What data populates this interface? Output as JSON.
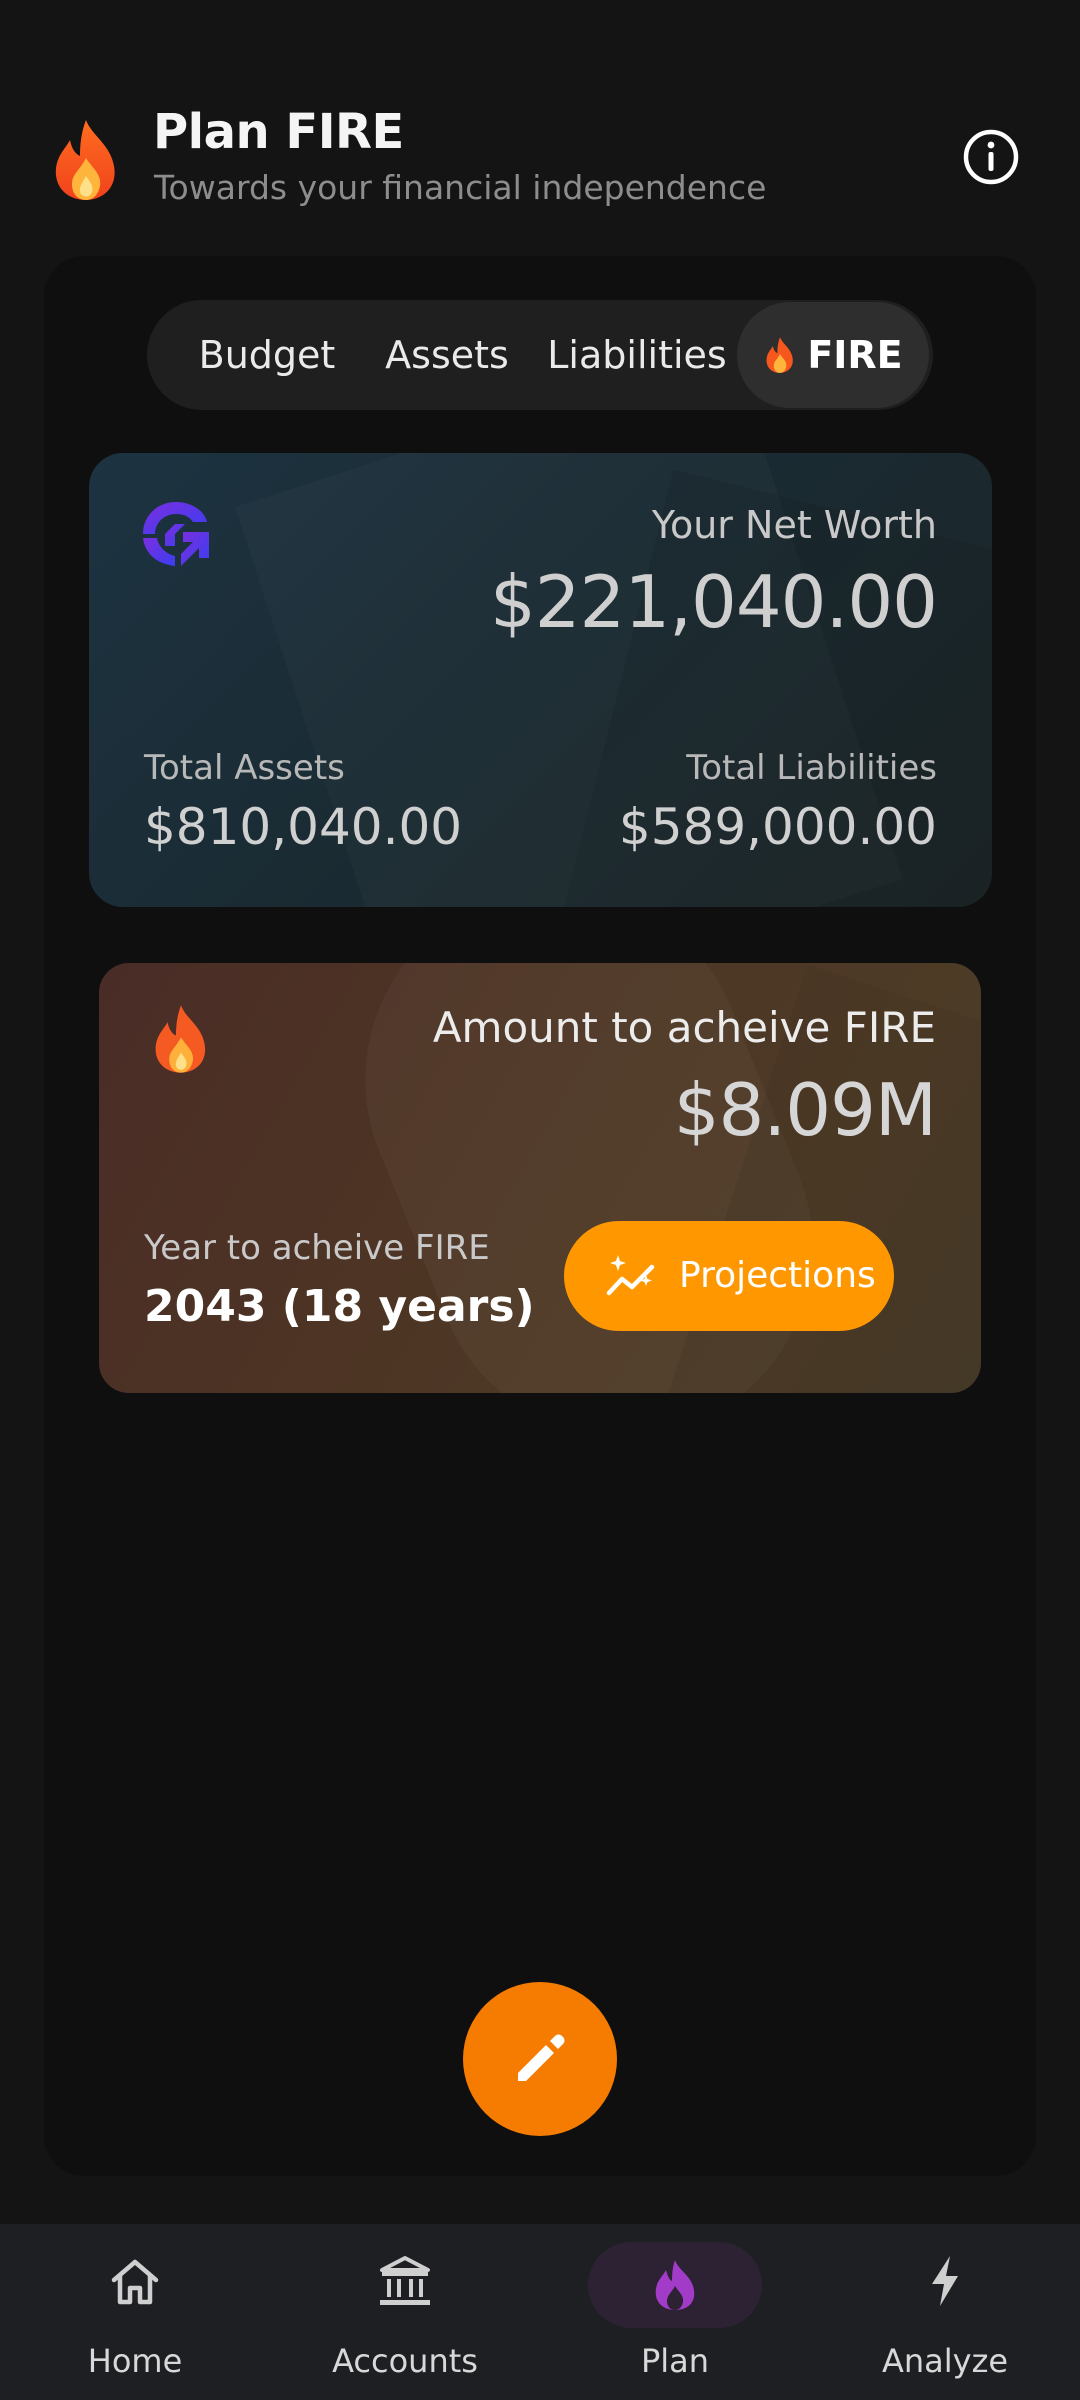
{
  "header": {
    "title": "Plan FIRE",
    "subtitle": "Towards your financial independence",
    "icon": "flame-icon",
    "info_icon": "info-icon"
  },
  "tabs": [
    {
      "label": "Budget",
      "selected": false
    },
    {
      "label": "Assets",
      "selected": false
    },
    {
      "label": "Liabilities",
      "selected": false
    },
    {
      "label": "FIRE",
      "selected": true
    }
  ],
  "net_worth_card": {
    "logo": "brand-logo-icon",
    "label": "Your Net Worth",
    "value": "$221,040.00",
    "total_assets_label": "Total Assets",
    "total_assets_value": "$810,040.00",
    "total_liabilities_label": "Total Liabilities",
    "total_liabilities_value": "$589,000.00"
  },
  "fire_card": {
    "icon": "flame-icon",
    "amount_label": "Amount to acheive FIRE",
    "amount_value": "$8.09M",
    "year_label": "Year to acheive FIRE",
    "year_value": "2043 (18 years)",
    "projections_button": "Projections",
    "projections_icon": "sparkle-chart-icon"
  },
  "fab": {
    "icon": "pencil-icon"
  },
  "bottom_nav": {
    "items": [
      {
        "label": "Home",
        "icon": "home-icon",
        "active": false
      },
      {
        "label": "Accounts",
        "icon": "bank-icon",
        "active": false
      },
      {
        "label": "Plan",
        "icon": "flame-icon",
        "active": true
      },
      {
        "label": "Analyze",
        "icon": "lightning-icon",
        "active": false
      }
    ]
  },
  "colors": {
    "background": "#141414",
    "accent_orange": "#ff9800",
    "fab_orange": "#f57c00",
    "plan_active": "#a23cc8"
  }
}
